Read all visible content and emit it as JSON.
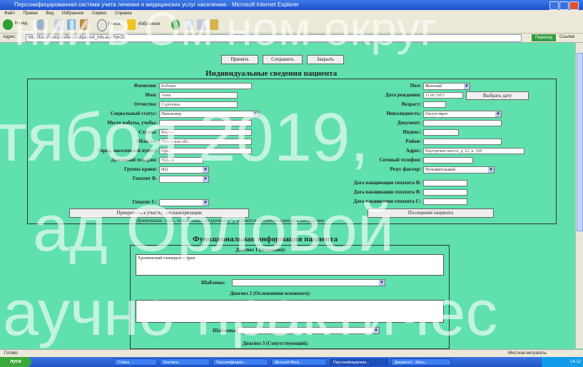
{
  "window": {
    "title": "Персонифицированная система учета лечения и медицинских услуг населению - Microsoft Internet Explorer",
    "menu": [
      "Файл",
      "Правка",
      "Вид",
      "Избранное",
      "Сервис",
      "Справка"
    ],
    "back_label": "Назад",
    "search_label": "Поиск",
    "favorites_label": "Избранное",
    "address_label": "Адрес:",
    "address_value": "http://localhost/persfile/card/patient_info.asp?id=23",
    "go_label": "Переход",
    "links_label": "Ссылки"
  },
  "toolbar": {
    "accept_label": "Принять",
    "save_label": "Сохранить",
    "close_label": "Закрыть"
  },
  "patient_info": {
    "title": "Индивидуальные сведения пациента",
    "surname_label": "Фамилия:",
    "surname_value": "Кобзева",
    "name_label": "Имя:",
    "name_value": "Анна",
    "patronymic_label": "Отчество:",
    "patronymic_value": "Сергеевна",
    "social_status_label": "Социальный статус:",
    "social_status_value": "Пенсионер",
    "workplace_label": "Место работы, учебы:",
    "workplace_value": "",
    "country_label": "Страна:",
    "country_value": "Россия",
    "region_label": "Область:",
    "region_value": "Орловская обл.",
    "city_label": "Город, населенный пункт:",
    "city_value": "Орел",
    "home_phone_label": "Домашний телефон:",
    "home_phone_value": "552218",
    "blood_group_label": "Группа крови:",
    "blood_group_value": "0(I)",
    "hepatitis_b_label": "Гепатит В:",
    "hepatitis_b_value": "",
    "hepatitis_c_label": "Гепатит С:",
    "hepatitis_c_value": "",
    "gender_label": "Пол:",
    "gender_value": "Женский",
    "birth_date_label": "Дата рождения:",
    "birth_date_value": "11.06.1951",
    "choose_date_label": "Выбрать дату",
    "age_label": "Возраст:",
    "age_value": "",
    "disability_label": "Инвалидность:",
    "disability_value": "Отсутствует",
    "disability_group_label": "Документ:",
    "index_label": "Индекс:",
    "district_label": "Район:",
    "address_label": "Адрес:",
    "address_value": "Наугорское шоссе, д. 12, к. 104",
    "mobile_label": "Сотовый телефон:",
    "rh_label": "Резус фактор:",
    "rh_value": "Положительный",
    "vacc_b_label": "Дата вакцинации гепатита В:",
    "vacc_b2_label": "Дата вакцинации гепатита В:",
    "vacc_c_label": "Дата вакцинации гепатита С:",
    "attach_button": "Прикрепить к участку диспансеризации",
    "prev_visits_button": "Посещения пациента",
    "note": "Примечание: поле, отмеченные звездочкой (*), являются обязательными для заполнения"
  },
  "functional_info": {
    "title": "Функциональная информация пациента",
    "diagnosis1_label": "Диагноз 1 (Основное):",
    "diagnosis1_value": "Хронический гломерулонефрит",
    "template_label": "Шаблоны:",
    "diagnosis2_label": "Диагноз 2 (Осложнения основного):",
    "diagnosis3_label": "Диагноз 3 (Сопутствующий):"
  },
  "statusbar": {
    "left": "Готово",
    "right": "Местная интрасеть"
  },
  "taskbar": {
    "start_label": "пуск",
    "tasks": [
      "2 Inbox",
      "Контакты",
      "Персонифициро...",
      "Microsoft Word...",
      "Персонифицирован...",
      "Документ1 - Micro..."
    ],
    "clock": "14:12"
  },
  "watermark": {
    "line1": "нии в Ом ном округ",
    "line2": "тябоя 2019,",
    "line3": "ад Орловой",
    "line4": "аучно-практичес"
  }
}
